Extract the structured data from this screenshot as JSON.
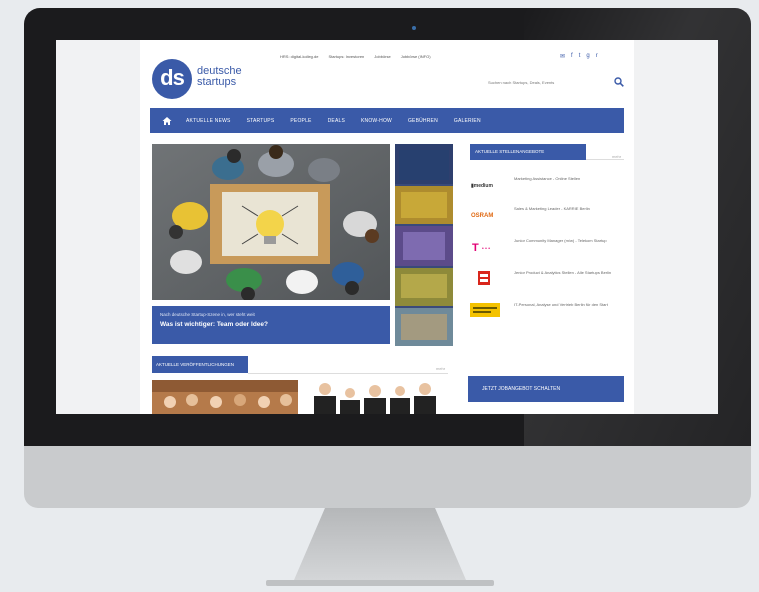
{
  "site": {
    "logo_initials": "ds",
    "logo_line1": "deutsche",
    "logo_line2": "startups"
  },
  "topnav": [
    "HRS: digital-kolleg.de",
    "Startups: Investoren",
    "Jobbörse",
    "Jobbörse (INFO)"
  ],
  "social": [
    "✉",
    "f",
    "t",
    "g",
    "r"
  ],
  "search": {
    "placeholder": "Suchen nach Startups, Deals, Events"
  },
  "mainnav": [
    "AKTUELLE NEWS",
    "STARTUPS",
    "PEOPLE",
    "DEALS",
    "KNOW-HOW",
    "GEBÜHREN",
    "GALERIEN"
  ],
  "hero": {
    "kicker": "Nach deutsche Startup-Szene in, wer steht weit",
    "title": "Was ist wichtiger: Team oder Idee?"
  },
  "jobs": {
    "heading": "AKTUELLE STELLENANGEBOTE",
    "more": "mehr",
    "items": [
      {
        "company": "Mediamarkt",
        "text": "Marketing Assistance - Online Stellen"
      },
      {
        "company": "OSRAM",
        "text": "Sales & Marketing Leader - KARRIE Berlin"
      },
      {
        "company": "Telekom",
        "text": "Junior Community Manager (m/w) - Telekom Startup"
      },
      {
        "company": "Edeka",
        "text": "Jenior Product & Analytics Stellen - Alle Startups Berlin"
      },
      {
        "company": "Yellow",
        "text": "IT-Personal, Analyse und Vertrieb Berlin für den Start"
      }
    ]
  },
  "cta": {
    "label": "JETZT JOBANGEBOT SCHALTEN"
  },
  "section": {
    "heading": "AKTUELLE VERÖFFENTLICHUNGEN",
    "more": "mehr"
  },
  "colors": {
    "brand": "#3a5aa8",
    "bezel": "#1b1b1d",
    "chin": "#c9cbcd"
  }
}
